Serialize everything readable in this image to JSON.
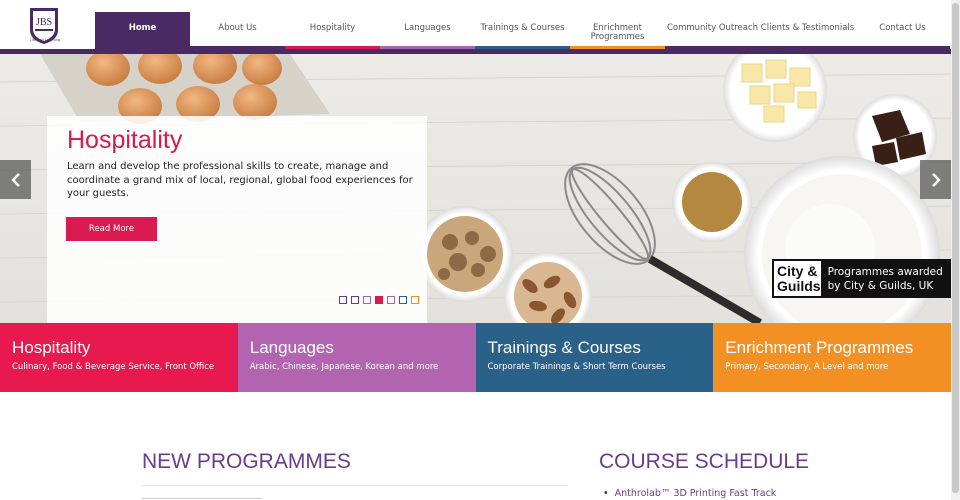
{
  "logo": {
    "initials": "JBS",
    "tagline": "Lifelong Learning"
  },
  "nav": {
    "items": [
      {
        "label": "Home",
        "color": "#4a2a63"
      },
      {
        "label": "About Us",
        "color": "#4a2a63"
      },
      {
        "label": "Hospitality",
        "color": "#d9194f"
      },
      {
        "label": "Languages",
        "color": "#a667b1"
      },
      {
        "label": "Trainings & Courses",
        "color": "#2a6188"
      },
      {
        "label": "Enrichment Programmes",
        "color": "#f39023"
      },
      {
        "label": "Community Outreach",
        "color": "#4a2a63"
      },
      {
        "label": "Clients & Testimonials",
        "color": "#4a2a63"
      },
      {
        "label": "Contact Us",
        "color": "#4a2a63"
      }
    ]
  },
  "hero": {
    "title": "Hospitality",
    "description": "Learn and develop the professional skills to create, manage and coordinate a grand mix of local, regional, global food experiences for your guests.",
    "button_label": "Read More",
    "prev_icon": "chevron-left-icon",
    "next_icon": "chevron-right-icon",
    "slides": [
      {
        "color": "#6b3b8a",
        "active": false
      },
      {
        "color": "#6b3b8a",
        "active": false
      },
      {
        "color": "#a667b1",
        "active": false
      },
      {
        "color": "#d9194f",
        "active": true
      },
      {
        "color": "#a667b1",
        "active": false
      },
      {
        "color": "#2a6188",
        "active": false
      },
      {
        "color": "#f39023",
        "active": false
      }
    ],
    "badge": {
      "logo_line1": "City &",
      "logo_line2": "Guilds",
      "text": "Programmes awarded by City & Guilds, UK"
    }
  },
  "tiles": [
    {
      "title": "Hospitality",
      "subtitle": "Culinary, Food & Beverage Service, Front Office",
      "color": "#e8194f"
    },
    {
      "title": "Languages",
      "subtitle": "Arabic, Chinese, Japanese, Korean and more",
      "color": "#b264b0"
    },
    {
      "title": "Trainings & Courses",
      "subtitle": "Corporate Trainings & Short Term Courses",
      "color": "#2a6188"
    },
    {
      "title": "Enrichment Programmes",
      "subtitle": "Primary, Secondary, A Level and more",
      "color": "#f39023"
    }
  ],
  "sections": {
    "new_programmes_title": "NEW PROGRAMMES",
    "course_schedule_title": "COURSE SCHEDULE",
    "schedule_items": [
      "Anthrolab™ 3D Printing Fast Track"
    ]
  }
}
